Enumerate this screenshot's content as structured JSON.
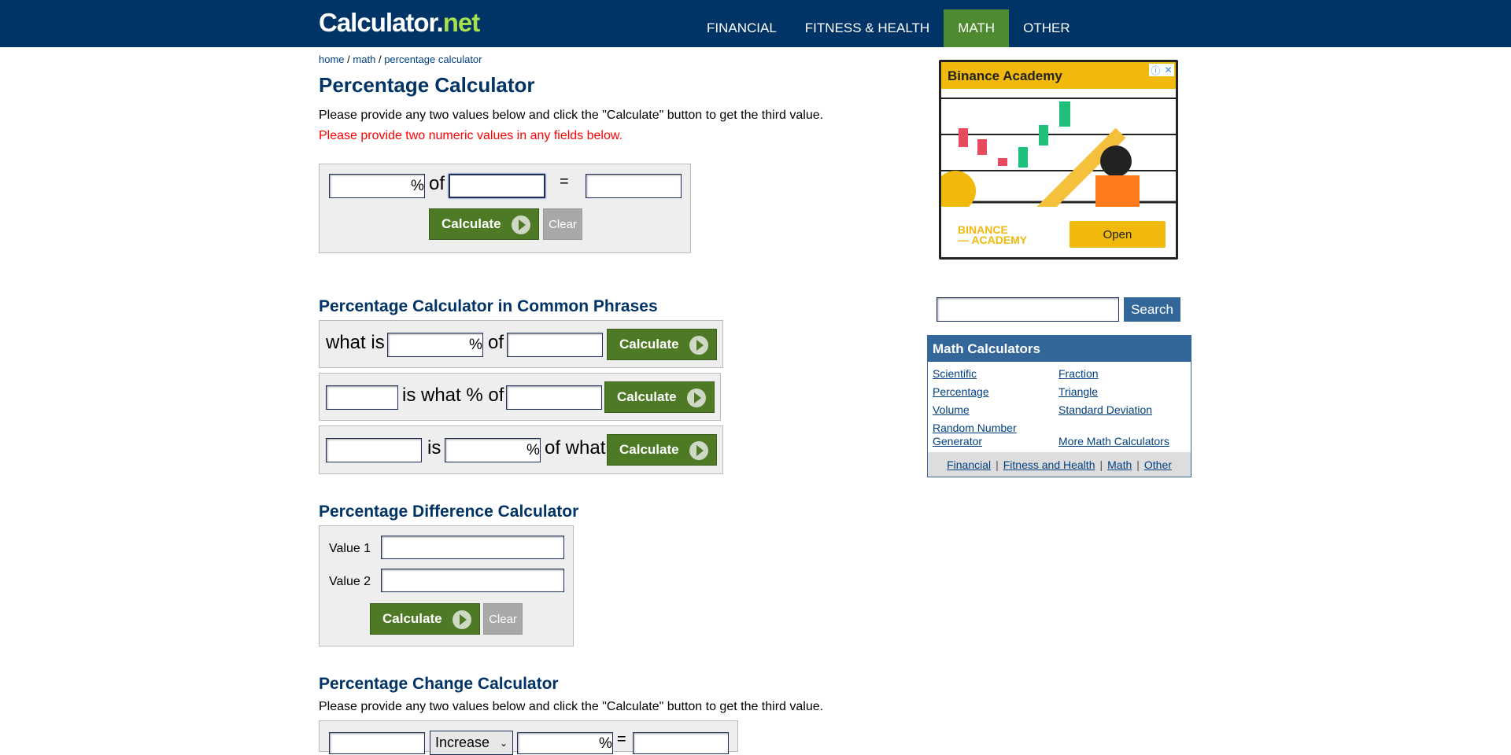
{
  "header": {
    "logo_main": "Calculator.",
    "logo_net": "net",
    "nav": [
      "FINANCIAL",
      "FITNESS & HEALTH",
      "MATH",
      "OTHER"
    ],
    "active_nav": "MATH"
  },
  "breadcrumb": {
    "home": "home",
    "sep": "/",
    "math": "math",
    "current": "percentage calculator"
  },
  "page": {
    "title": "Percentage Calculator",
    "intro": "Please provide any two values below and click the \"Calculate\" button to get the third value.",
    "error": "Please provide two numeric values in any fields below."
  },
  "calc1": {
    "pct": "%",
    "of": "of",
    "eq": "=",
    "calculate": "Calculate",
    "clear": "Clear"
  },
  "phrases": {
    "title": "Percentage Calculator in Common Phrases",
    "row1": {
      "what_is": "what is",
      "pct": "%",
      "of": "of",
      "calculate": "Calculate"
    },
    "row2": {
      "is_what": "is what % of",
      "calculate": "Calculate"
    },
    "row3": {
      "is": "is",
      "pct": "%",
      "of_what": "of what",
      "calculate": "Calculate"
    }
  },
  "difference": {
    "title": "Percentage Difference Calculator",
    "value1": "Value 1",
    "value2": "Value 2",
    "calculate": "Calculate",
    "clear": "Clear"
  },
  "change": {
    "title": "Percentage Change Calculator",
    "intro": "Please provide any two values below and click the \"Calculate\" button to get the third value.",
    "select": "Increase",
    "pct": "%",
    "eq": "="
  },
  "ad": {
    "header": "Binance Academy",
    "brand": "BINANCE\n— ACADEMY",
    "open": "Open"
  },
  "search": {
    "button": "Search"
  },
  "math_calcs": {
    "title": "Math Calculators",
    "links": [
      "Scientific",
      "Fraction",
      "Percentage",
      "Triangle",
      "Volume",
      "Standard Deviation",
      "Random Number Generator",
      "More Math Calculators"
    ],
    "footer": [
      "Financial",
      "Fitness and Health",
      "Math",
      "Other"
    ],
    "footer_sep": "|"
  },
  "colors": {
    "header_bg": "#003366",
    "active_nav": "#4e8a2f",
    "button_green": "#4e7a25",
    "error_red": "#ff0000"
  }
}
